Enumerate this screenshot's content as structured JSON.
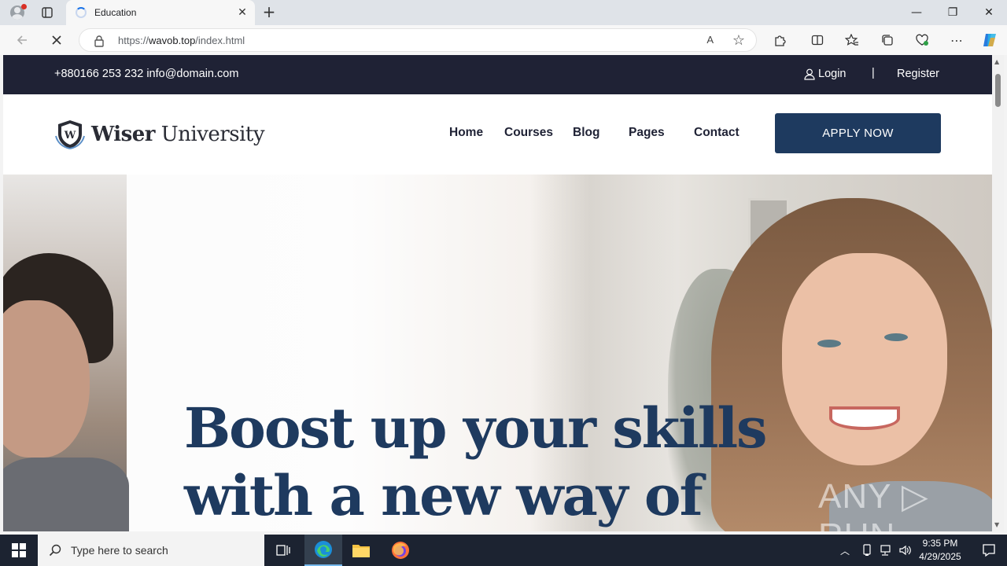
{
  "browser": {
    "tab_title": "Education",
    "url_prefix": "https://",
    "url_domain": "wavob.top",
    "url_path": "/index.html",
    "read_aloud": "A",
    "close_tab": "✕",
    "new_tab": "+"
  },
  "window_controls": {
    "minimize": "—",
    "restore": "❐",
    "close": "✕"
  },
  "site": {
    "topbar": {
      "contact": "+880166 253 232 info@domain.com",
      "login": "Login",
      "separator": "|",
      "register": "Register"
    },
    "logo": {
      "bold": "Wiser",
      "rest": " University"
    },
    "nav": {
      "home": "Home",
      "courses": "Courses",
      "blog": "Blog",
      "pages": "Pages",
      "contact": "Contact",
      "caret": "⌵"
    },
    "apply_button": "APPLY NOW",
    "hero": {
      "line1": "Boost up your skills",
      "line2": "with a new way of"
    },
    "watermark": "ANY ▷ RUN"
  },
  "taskbar": {
    "search_placeholder": "Type here to search",
    "time": "9:35 PM",
    "date": "4/29/2025"
  }
}
